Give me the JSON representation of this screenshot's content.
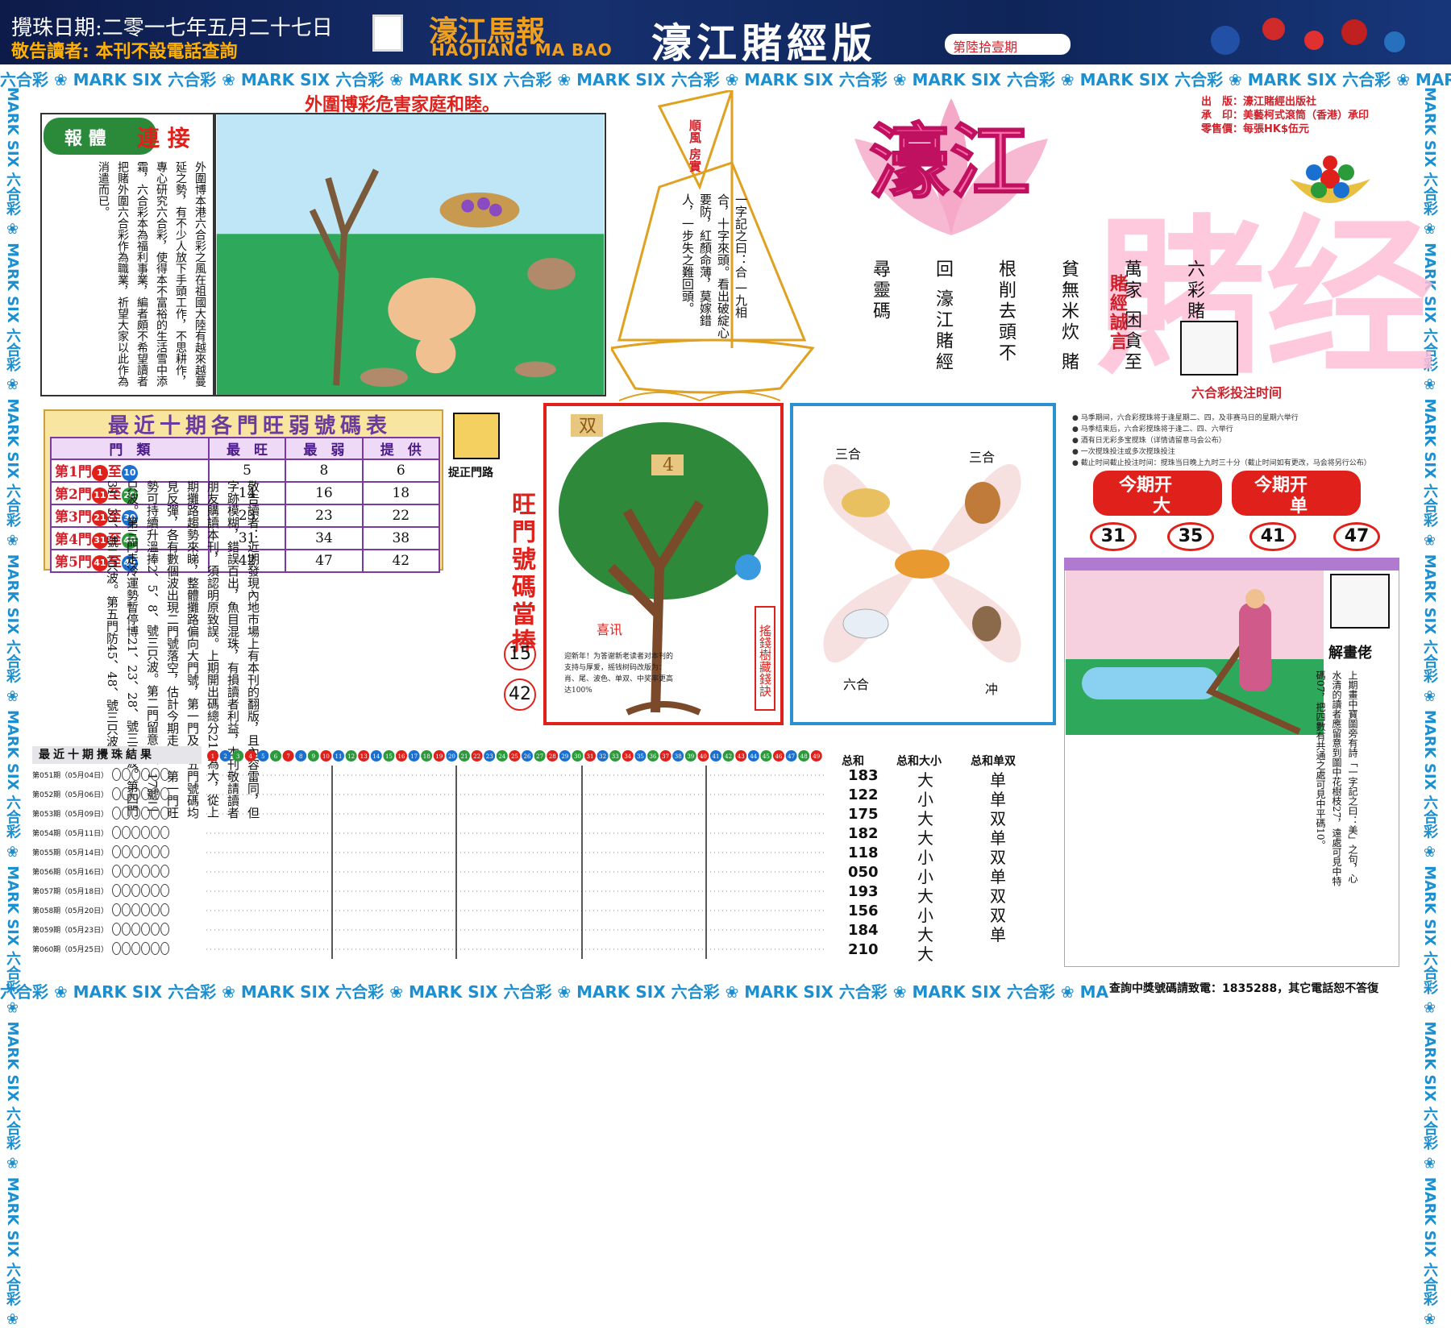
{
  "header": {
    "draw_date": "攪珠日期:二零一七年五月二十七日",
    "notice": "敬告讀者: 本刊不設電話查詢",
    "masthead_cn": "濠江馬報",
    "masthead_en": "HAOJIANG MA BAO",
    "edition": "濠江賭經版",
    "issue": "第陸拾壹期"
  },
  "band_text": "六合彩 ❀ MARK SIX 六合彩 ❀ MARK SIX 六合彩 ❀ MARK SIX 六合彩 ❀ MARK SIX 六合彩 ❀ MARK SIX 六合彩 ❀ MARK SIX 六合彩 ❀ MARK SIX 六合彩 ❀ MARK SIX 六合彩 ❀ MARK SIX 六合彩 ❀ MARK SIX 六合彩 ❀ MARK SIX",
  "vband_text": "MARK SIX 六合彩 ❀ MARK SIX 六合彩 ❀ MARK SIX 六合彩 ❀ MARK SIX 六合彩 ❀ MARK SIX 六合彩 ❀ MARK SIX 六合彩 ❀ MARK SIX 六合彩 ❀ MARK SIX 六合彩 ❀",
  "slogan": "外圍博彩危害家庭和睦。",
  "article": {
    "badge_a": "報 體",
    "badge_b": "連 接",
    "text": "外圍博本港六合彩之風在祖國大陸有越來越蔓延之勢，有不少人放下手頭工作，不思耕作，專心研究六合彩，使得本不富裕的生活雪中添霜，六合彩本為福利事業，編者頗不希望讀者把賭外圍六合彩作為職業，祈望大家以此作為消遣而已。"
  },
  "sail": {
    "flag": "順風 房實",
    "text": "一字記之曰：合 一九相合，十字來頭。看出破綻心要防，紅顏命薄，莫嫁錯人，一步失之難回頭。"
  },
  "brand": {
    "big_a": "濠江",
    "big_b": "賭经",
    "motto": [
      "六彩賭患禍萬家",
      "困貪至貧無米炊",
      "賭根削去頭不回",
      "濠江賭經尋靈碼"
    ],
    "motto_label": "賭經誠言",
    "publisher_lines": [
      "出　版：濠江賭經出版社",
      "承　印：美藝柯式滾筒（香港）承印",
      "零售價：每張HK$伍元"
    ],
    "bet_time_title": "六合彩投注时间",
    "bet_rules": [
      "● 马季期间，六合彩搅珠将于逢星期二、四，及非赛马日的星期六举行",
      "● 马季结束后，六合彩搅珠将于逢二、四、六举行",
      "● 酒有日无彩多宝搅珠（详情请留意马会公布）",
      "● 一次搅珠投注或多次搅珠投注",
      "● 截止时间截止投注时间：搅珠当日晚上九时三十分（截止时间如有更改，马会将另行公布）"
    ]
  },
  "table": {
    "title": "最近十期各門旺弱號碼表",
    "headers": [
      "門　類",
      "最　旺",
      "最　弱",
      "提　供"
    ],
    "rows": [
      {
        "door": "第1門",
        "from": "1",
        "to": "10",
        "max": "5",
        "min": "8",
        "offer": "6"
      },
      {
        "door": "第2門",
        "from": "11",
        "to": "20",
        "max": "14",
        "min": "16",
        "offer": "18"
      },
      {
        "door": "第3門",
        "from": "21",
        "to": "30",
        "max": "23",
        "min": "23",
        "offer": "22"
      },
      {
        "door": "第4門",
        "from": "31",
        "to": "40",
        "max": "31",
        "min": "34",
        "offer": "38"
      },
      {
        "door": "第5門",
        "from": "41",
        "to": "49",
        "max": "42",
        "min": "47",
        "offer": "42"
      }
    ],
    "to_word": "至",
    "colors": {
      "red": "#e0201a",
      "green": "#2a9a3a",
      "blue": "#1a70d0"
    }
  },
  "door": {
    "label": "捉正門路",
    "notes": "模糊，錯誤百出，魚目混珠，有損讀者利益，本刊敬請讀者朋友購讀本刊，須認明原致誤。上期開出碼總分210為大，從上期攤路趨勢來睇，整體攤路偏向大門號，第一門及第五門號碼均見反彈，各有數個波出現二門號落空，估計今期走勢，第一門旺勢可持續升溫捧2、5、8、號三只波。第二門留意12、17號二只波。第三門走冷運勢暫停博21、23、28、號三只波。第四門31、33、號二只波。第五門防45、48、號三只波。",
    "reader_notice": "敬告讀者：近期發現內地市場上有本刊的翻版，且內容雷同，但字跡",
    "hot_title": "旺門號碼當捧",
    "hot_numbers": [
      "15",
      "42"
    ]
  },
  "tree": {
    "tags": [
      "双",
      "4"
    ],
    "side": "搖錢樹藏錢訣",
    "news_title": "喜讯",
    "news_text": "迎新年！为答谢新老读者对本刊的支持与厚爱，摇钱树码改版为：肖、尾、波色、单双、中奖率更高达100%"
  },
  "zodiac": {
    "tl": "三合",
    "tr": "三合",
    "bl": "六合",
    "br": "冲"
  },
  "open": {
    "labels": [
      "今期开",
      "今期开"
    ],
    "values": [
      "大",
      "单"
    ],
    "numbers": [
      "31",
      "35",
      "41",
      "47"
    ]
  },
  "painting": {
    "label": "解畫佬",
    "text": "上期畫中寶圖旁有詩「一字記之曰：美」之句，心水清的讀者應留意到圖中花樹枝27，遠處可見中特碼07，把四數有共通之處可見中平碼10。"
  },
  "results": {
    "title": "最近十期攪珠結果",
    "numbers": [
      "1",
      "2",
      "3",
      "4",
      "5",
      "6",
      "7",
      "8",
      "9",
      "10",
      "11",
      "12",
      "13",
      "14",
      "15",
      "16",
      "17",
      "18",
      "19",
      "20",
      "21",
      "22",
      "23",
      "24",
      "25",
      "26",
      "27",
      "28",
      "29",
      "30",
      "31",
      "32",
      "33",
      "34",
      "35",
      "36",
      "37",
      "38",
      "39",
      "40",
      "41",
      "42",
      "43",
      "44",
      "45",
      "46",
      "47",
      "48",
      "49"
    ],
    "periods": [
      "第051期（05月04日）",
      "第052期（05月06日）",
      "第053期（05月09日）",
      "第054期（05月11日）",
      "第055期（05月14日）",
      "第056期（05月16日）",
      "第057期（05月18日）",
      "第058期（05月20日）",
      "第059期（05月23日）",
      "第060期（05月25日）"
    ],
    "headers": [
      "总和",
      "总和大小",
      "总和单双"
    ],
    "sums": [
      "183",
      "122",
      "175",
      "182",
      "118",
      "050",
      "193",
      "156",
      "184",
      "210"
    ],
    "size": [
      "大",
      "小",
      "大",
      "大",
      "小",
      "小",
      "大",
      "小",
      "大",
      "大"
    ],
    "parity": [
      "单",
      "单",
      "双",
      "单",
      "双",
      "单",
      "双",
      "双",
      "单",
      ""
    ]
  },
  "hotline": "查詢中獎號碼請致電：1835288，其它電話恕不答復"
}
